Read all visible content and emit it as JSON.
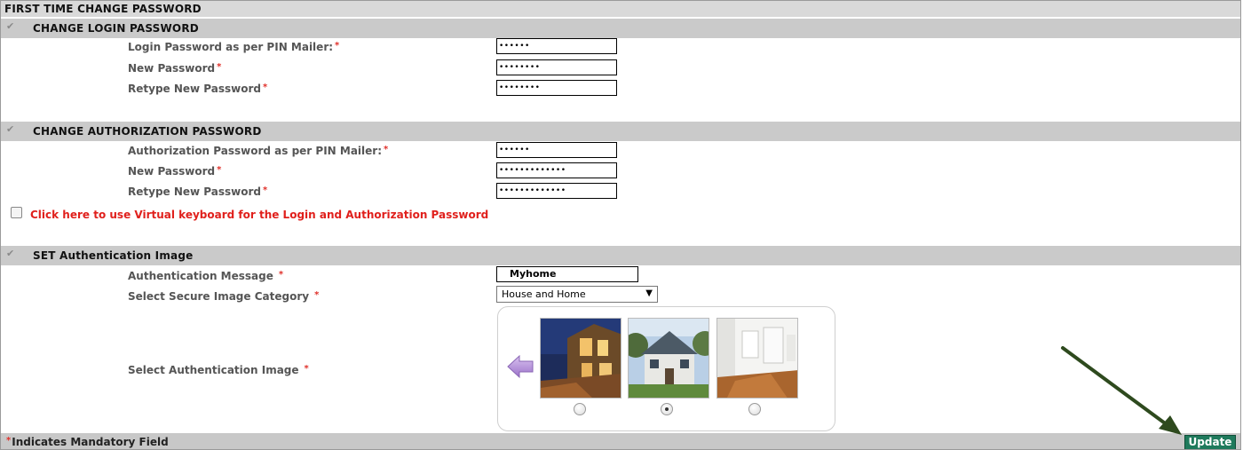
{
  "page_title": "FIRST TIME CHANGE PASSWORD",
  "login_section": {
    "title": "CHANGE LOGIN PASSWORD",
    "fields": [
      {
        "label": "Login Password as per PIN Mailer:",
        "value": "••••••"
      },
      {
        "label": "New Password",
        "value": "••••••••"
      },
      {
        "label": "Retype New Password",
        "value": "••••••••"
      }
    ]
  },
  "auth_section": {
    "title": "CHANGE AUTHORIZATION PASSWORD",
    "fields": [
      {
        "label": "Authorization Password as per PIN Mailer:",
        "value": "••••••"
      },
      {
        "label": "New Password",
        "value": "•••••••••••••"
      },
      {
        "label": "Retype New Password",
        "value": "•••••••••••••"
      }
    ]
  },
  "virtual_keyboard": {
    "label": "Click here to use Virtual keyboard for the Login and Authorization Password",
    "checked": false
  },
  "image_section": {
    "title": "SET Authentication Image",
    "message_label": "Authentication Message",
    "message_value": "Myhome",
    "category_label": "Select Secure Image Category",
    "category_value": "House and Home",
    "image_label": "Select Authentication Image",
    "images": [
      "house-night-image",
      "house-front-image",
      "interior-room-image"
    ],
    "selected_image_index": 1
  },
  "required_marker": "*",
  "footer": {
    "mandatory_note": "Indicates Mandatory Field",
    "update_label": "Update"
  },
  "colors": {
    "section_header_bg": "#cacaca",
    "required": "#e0302a",
    "update_button": "#1f7a5c",
    "annotation_arrow": "#2e4a1e"
  }
}
